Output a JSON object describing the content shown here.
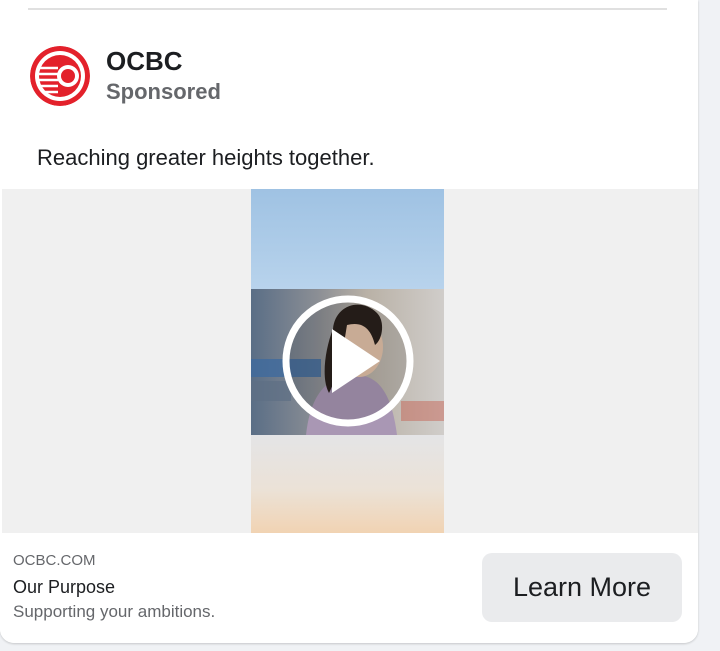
{
  "post": {
    "page_name": "OCBC",
    "sponsored_label": "Sponsored",
    "caption": "Reaching greater heights together."
  },
  "link": {
    "domain": "OCBC.COM",
    "headline": "Our Purpose",
    "description": "Supporting your ambitions.",
    "cta_label": "Learn More"
  },
  "icons": {
    "avatar": "ocbc-logo",
    "play": "play-icon"
  },
  "colors": {
    "brand_red": "#e3212b",
    "text_primary": "#1c1e21",
    "text_secondary": "#65676b",
    "cta_background": "#eaebed"
  }
}
